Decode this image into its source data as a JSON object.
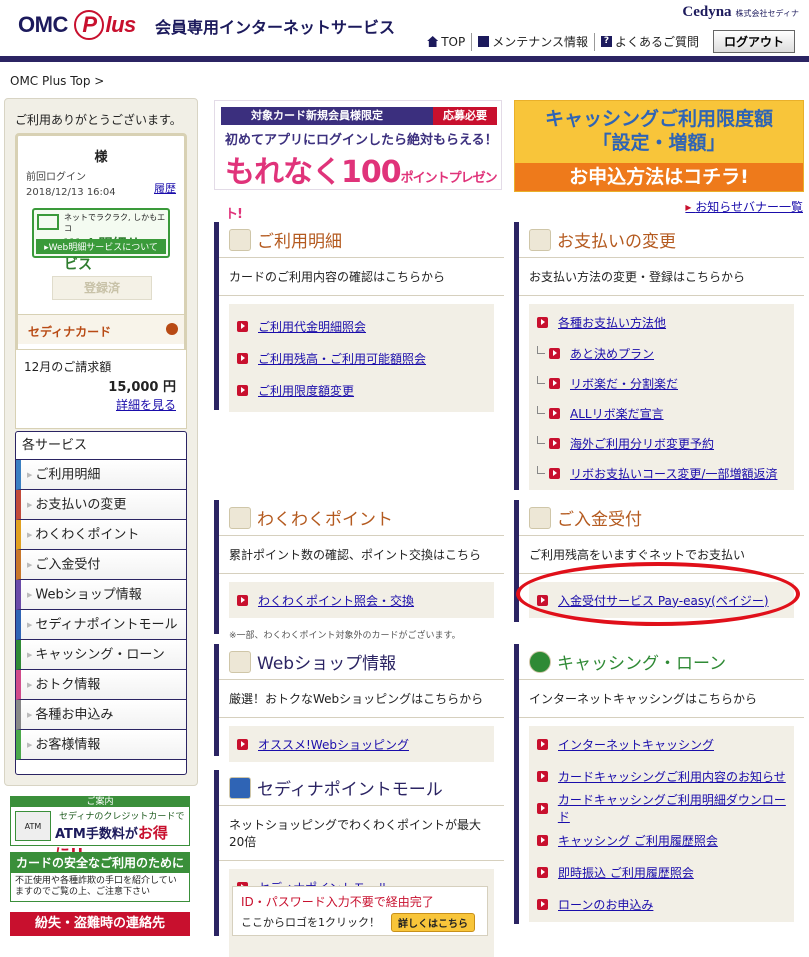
{
  "header": {
    "logo_omc": "OMC",
    "logo_p": "P",
    "logo_lus": "lus",
    "service_title": "会員専用インターネットサービス",
    "brand": "Cedyna",
    "brand_sub": "株式会社セディナ",
    "nav": [
      {
        "label": "TOP",
        "icon": "home-icon"
      },
      {
        "label": "メンテナンス情報",
        "icon": "info-icon"
      },
      {
        "label": "よくあるご質問",
        "icon": "question-icon"
      }
    ],
    "logout": "ログアウト"
  },
  "breadcrumb": "OMC Plus Top >",
  "sidebar": {
    "thanks": "ご利用ありがとうございます。",
    "user_honorific": "様",
    "last_login_label": "前回ログイン",
    "last_login_time": "2018/12/13 16:04",
    "history_link": "履歴",
    "web_statement": {
      "line1": "ネットでラクラク, しかもエコ",
      "title": "Web明細サービス",
      "about": "▸Web明細サービスについて"
    },
    "registered": "登録済",
    "card_name": "セディナカード",
    "billing_label": "12月のご請求額",
    "billing_amount": "15,000 円",
    "details_link": "詳細を見る",
    "services_header": "各サービス",
    "services": [
      {
        "label": "ご利用明細",
        "color": "#3a7fc2"
      },
      {
        "label": "お支払いの変更",
        "color": "#c24a3a"
      },
      {
        "label": "わくわくポイント",
        "color": "#e0a020"
      },
      {
        "label": "ご入金受付",
        "color": "#c8762a"
      },
      {
        "label": "Webショップ情報",
        "color": "#6a4aa8"
      },
      {
        "label": "セディナポイントモール",
        "color": "#2f64b5"
      },
      {
        "label": "キャッシング・ローン",
        "color": "#2f8a35"
      },
      {
        "label": "おトク情報",
        "color": "#d04a8a"
      },
      {
        "label": "各種お申込み",
        "color": "#888888"
      },
      {
        "label": "お客様情報",
        "color": "#4aa84a"
      }
    ]
  },
  "ads_left": {
    "atm_header": "ご案内",
    "atm_line1": "セディナのクレジットカードで",
    "atm_line2a": "ATM手数料が",
    "atm_line2b": "お得に!!",
    "atm_icon": "ATM",
    "safety_title": "カードの安全なご利用のために",
    "safety_body": "不正使用や各種詐欺の手口を紹介していますのでご覧の上、ご注意下さい",
    "lost_title": "紛失・盗難時の連絡先"
  },
  "banners": {
    "app_top": "対象カード新規会員様限定",
    "app_tag": "応募必要",
    "app_mid": "初めてアプリにログインしたら絶対もらえる！",
    "app_big": "もれなく100",
    "app_unit": "ポイントプレゼント!",
    "cash_line1": "キャッシングご利用限度額",
    "cash_line2": "「設定・増額」",
    "cash_cta": "お申込方法はコチラ!",
    "notice_link": "お知らせバナー一覧"
  },
  "panels": {
    "meisai": {
      "title": "ご利用明細",
      "desc": "カードのご利用内容の確認はこちらから",
      "links": [
        "ご利用代金明細照会",
        "ご利用残高・ご利用可能額照会",
        "ご利用限度額変更"
      ]
    },
    "shiharai": {
      "title": "お支払いの変更",
      "desc": "お支払い方法の変更・登録はこちらから",
      "links": [
        "各種お支払い方法他"
      ],
      "sublinks": [
        "あと決めプラン",
        "リボ楽だ・分割楽だ",
        "ALLリボ楽だ宣言",
        "海外ご利用分リボ変更予約",
        "リボお支払いコース変更/一部増額返済"
      ]
    },
    "point": {
      "title": "わくわくポイント",
      "desc": "累計ポイント数の確認、ポイント交換はこちら",
      "links": [
        "わくわくポイント照会・交換"
      ],
      "note": "※一部、わくわくポイント対象外のカードがございます。"
    },
    "nyukin": {
      "title": "ご入金受付",
      "desc": "ご利用残高をいますぐネットでお支払い",
      "links": [
        "入金受付サービス Pay-easy(ペイジー)"
      ]
    },
    "webshop": {
      "title": "Webショップ情報",
      "desc": "厳選！おトクなWebショッピングはこちらから",
      "links": [
        "オススメ!Webショッピング"
      ]
    },
    "cashing": {
      "title": "キャッシング・ローン",
      "desc": "インターネットキャッシングはこちらから",
      "links": [
        "インターネットキャッシング",
        "カードキャッシングご利用内容のお知らせ",
        "カードキャッシングご利用明細ダウンロード",
        "キャッシング ご利用履歴照会",
        "即時振込 ご利用履歴照会",
        "ローンのお申込み"
      ]
    },
    "mall": {
      "title": "セディナポイントモール",
      "desc": "ネットショッピングでわくわくポイントが最大20倍",
      "links": [
        "セディナポイントモール"
      ],
      "idpw": "ID・パスワード入力不要で経由完了",
      "click": "ここからロゴを1クリック！",
      "detail_btn": "詳しくはこちら"
    }
  }
}
